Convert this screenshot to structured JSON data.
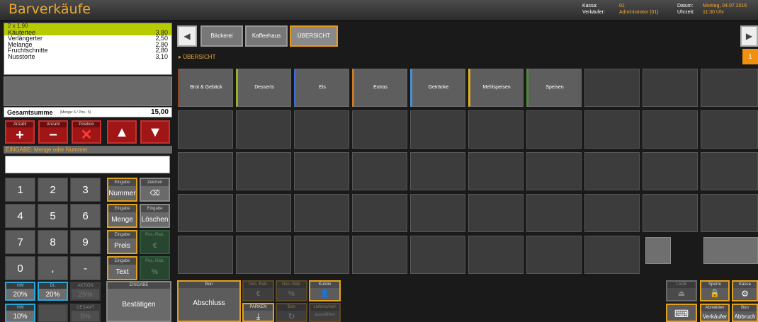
{
  "header": {
    "title": "Barverkäufe",
    "kassa_label": "Kassa:",
    "kassa_value": "01",
    "verkaeufer_label": "Verkäufer:",
    "verkaeufer_value": "Administrator (01)",
    "datum_label": "Datum:",
    "datum_value": "Montag, 04.07.2016",
    "uhrzeit_label": "Uhrzeit:",
    "uhrzeit_value": "11:30 Uhr"
  },
  "order": {
    "sub_line": "2 x 1,90",
    "items": [
      {
        "name": "Käutertee",
        "price": "3,80"
      },
      {
        "name": "Verlängerter",
        "price": "2,50"
      },
      {
        "name": "Melange",
        "price": "2,80"
      },
      {
        "name": "Fruchtschnitte",
        "price": "2,80"
      },
      {
        "name": "Nusstorte",
        "price": "3,10"
      }
    ],
    "total_label": "Gesamtsumme",
    "total_meta": "(Menge: 6 / Pos.: 5)",
    "total_value": "15,00"
  },
  "qty_buttons": [
    {
      "label": "Anzahl",
      "symbol": "+"
    },
    {
      "label": "Anzahl",
      "symbol": "−"
    },
    {
      "label": "Position",
      "symbol": "✕"
    },
    {
      "label": "",
      "symbol": "▲"
    },
    {
      "label": "",
      "symbol": "▼"
    }
  ],
  "eingabe_header": "EINGABE: Menge oder Nummer",
  "keypad": [
    "1",
    "2",
    "3",
    "4",
    "5",
    "6",
    "7",
    "8",
    "9",
    "0",
    ",",
    "-"
  ],
  "side_buttons": [
    {
      "l1": "Eingabe",
      "l2": "Nummer"
    },
    {
      "l1": "Zeichen",
      "l2": "⌫"
    },
    {
      "l1": "Eingabe",
      "l2": "Menge"
    },
    {
      "l1": "Eingabe",
      "l2": "Löschen"
    },
    {
      "l1": "Eingabe",
      "l2": "Preis"
    },
    {
      "l1": "Pos.-Rab.",
      "l2": "€"
    },
    {
      "l1": "Eingabe",
      "l2": "Text"
    },
    {
      "l1": "Pos.-Rab.",
      "l2": "%"
    }
  ],
  "discounts": [
    {
      "l1": "HW",
      "l2": "20%"
    },
    {
      "l1": "DL",
      "l2": "20%"
    },
    {
      "l1": "AKTION",
      "l2": "25%"
    },
    {
      "l1": "HW",
      "l2": "10%"
    },
    {
      "l1": "",
      "l2": ""
    },
    {
      "l1": "GESAMT",
      "l2": "5%"
    }
  ],
  "confirm": {
    "l1": "EINGABE",
    "l2": "Bestätigen"
  },
  "nav": {
    "back": "◀",
    "forward": "▶",
    "tabs": [
      "Bäckerei",
      "Kaffeehaus",
      "ÜBERSICHT"
    ],
    "breadcrumb": "▸ ÜBERSICHT",
    "page": "1"
  },
  "categories": [
    {
      "name": "Brot & Gebäck",
      "accent": "#8a4a2a"
    },
    {
      "name": "Desserts",
      "accent": "#9ab022"
    },
    {
      "name": "Eis",
      "accent": "#3a6ad0"
    },
    {
      "name": "Extras",
      "accent": "#d07a20"
    },
    {
      "name": "Getränke",
      "accent": "#4a90d0"
    },
    {
      "name": "Mehlspeisen",
      "accent": "#e0b020"
    },
    {
      "name": "Speisen",
      "accent": "#4a8a3a"
    }
  ],
  "bottom": {
    "bon": {
      "l1": "Bon",
      "l2": "Abschluss"
    },
    "ges_rab_eur": {
      "l1": "Ges.-Rab.",
      "l2": "€"
    },
    "ges_rab_pct": {
      "l1": "Ges.-Rab.",
      "l2": "%"
    },
    "kunde": {
      "l1": "Kunde",
      "l2": "👤"
    },
    "parken": {
      "l1": "PARKEN",
      "l2": "⤓"
    },
    "bon_reload": {
      "l1": "Bon",
      "l2": "↻"
    },
    "lieferschein": {
      "l1": "Lieferschein",
      "l2": "auswählen"
    },
    "lade": {
      "l1": "LADE",
      "l2": "⏏"
    },
    "sperre": {
      "l1": "Sperre",
      "l2": "🔒"
    },
    "kassa": {
      "l1": "Kassa",
      "l2": "⚙"
    },
    "keyboard": {
      "l1": "",
      "l2": "⌨"
    },
    "abmelden": {
      "l1": "Abmelden",
      "l2": "Verkäufer"
    },
    "abbruch": {
      "l1": "Bon",
      "l2": "Abbruch"
    }
  }
}
